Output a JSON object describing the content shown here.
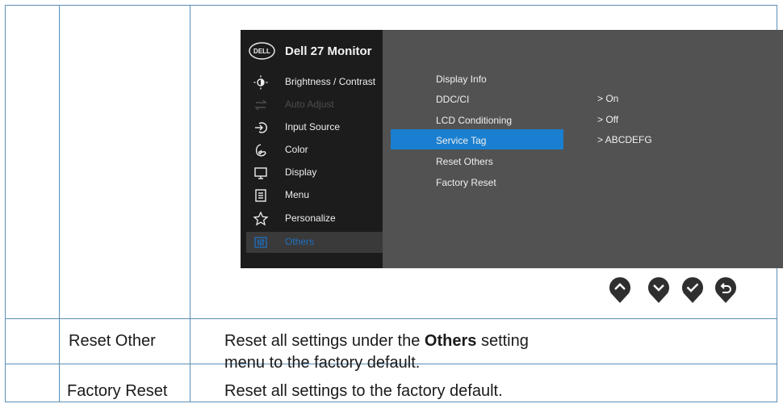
{
  "osd": {
    "title": "Dell 27 Monitor",
    "logo_text": "DELL",
    "menu_items": [
      {
        "label": "Brightness / Contrast",
        "icon": "brightness-icon",
        "state": "normal"
      },
      {
        "label": "Auto Adjust",
        "icon": "auto-adjust-icon",
        "state": "disabled"
      },
      {
        "label": "Input Source",
        "icon": "input-source-icon",
        "state": "normal"
      },
      {
        "label": "Color",
        "icon": "color-icon",
        "state": "normal"
      },
      {
        "label": "Display",
        "icon": "display-icon",
        "state": "normal"
      },
      {
        "label": "Menu",
        "icon": "menu-icon",
        "state": "normal"
      },
      {
        "label": "Personalize",
        "icon": "star-icon",
        "state": "normal"
      },
      {
        "label": "Others",
        "icon": "others-icon",
        "state": "active"
      }
    ],
    "submenu_items": [
      {
        "label": "Display Info"
      },
      {
        "label": "DDC/CI"
      },
      {
        "label": "LCD Conditioning"
      },
      {
        "label": "Service Tag",
        "selected": true
      },
      {
        "label": "Reset Others"
      },
      {
        "label": "Factory Reset"
      }
    ],
    "values": [
      {
        "label": "> On"
      },
      {
        "label": "> Off"
      },
      {
        "label": "> ABCDEFG"
      }
    ],
    "nav_buttons": [
      {
        "icon": "up-icon"
      },
      {
        "icon": "down-icon"
      },
      {
        "icon": "check-icon"
      },
      {
        "icon": "back-icon"
      }
    ],
    "colors": {
      "left_panel": "#1c1c1c",
      "right_panel": "#525252",
      "highlight": "#1a7fd0",
      "active_text": "#1f6fc0"
    }
  },
  "table": {
    "rows": [
      {
        "name": "Reset Other",
        "desc_before": "Reset all settings under the ",
        "desc_bold": "Others",
        "desc_after": " setting",
        "desc_line2": "menu to the factory default."
      },
      {
        "name": "Factory Reset",
        "desc": "Reset all settings to the factory default."
      }
    ]
  }
}
